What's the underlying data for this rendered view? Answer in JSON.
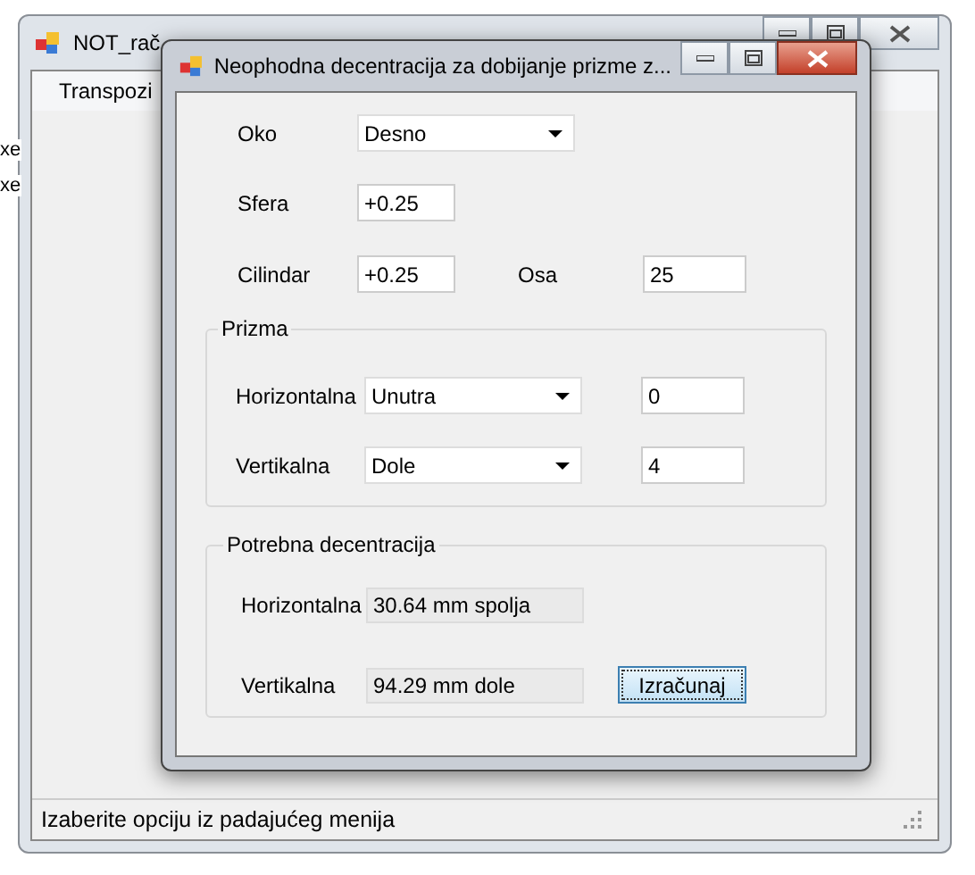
{
  "main_window": {
    "title": "NOT_rač",
    "menu": [
      "Transpozi"
    ],
    "side_texts": [
      "xe",
      "xe"
    ],
    "status_bar": "Izaberite opciju iz padajućeg menija"
  },
  "dialog": {
    "title": "Neophodna decentracija za dobijanje prizme z...",
    "eye": {
      "label": "Oko",
      "value": "Desno"
    },
    "sphere": {
      "label": "Sfera",
      "value": "+0.25"
    },
    "cylinder": {
      "label": "Cilindar",
      "value": "+0.25"
    },
    "axis": {
      "label": "Osa",
      "value": "25"
    },
    "prism": {
      "title": "Prizma",
      "rows": [
        {
          "label": "Horizontalna",
          "direction": "Unutra",
          "value": "0"
        },
        {
          "label": "Vertikalna",
          "direction": "Dole",
          "value": "4"
        }
      ]
    },
    "result": {
      "title": "Potrebna decentracija",
      "rows": [
        {
          "label": "Horizontalna",
          "value": "30.64 mm spolja"
        },
        {
          "label": "Vertikalna",
          "value": "94.29 mm dole"
        }
      ]
    },
    "button": "Izračunaj"
  }
}
